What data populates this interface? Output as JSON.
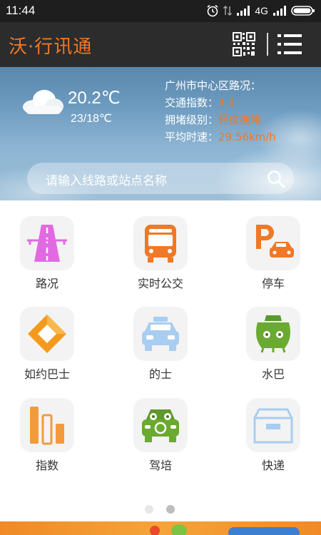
{
  "status_bar": {
    "time": "11:44",
    "network": "4G"
  },
  "app": {
    "title": "沃·行讯通"
  },
  "weather": {
    "temperature": "20.2℃",
    "range": "23/18℃",
    "icon": "cloudy-icon"
  },
  "traffic": {
    "area": "广州市中心区路况：",
    "index_label": "交通指数：",
    "index_value": "4.1",
    "level_label": "拥堵级别：",
    "level_value": "轻度拥堵",
    "speed_label": "平均时速：",
    "speed_value": "29.56km/h"
  },
  "search": {
    "placeholder": "请输入线路或站点名称"
  },
  "grid": [
    {
      "label": "路况",
      "icon": "road-icon"
    },
    {
      "label": "实时公交",
      "icon": "bus-icon"
    },
    {
      "label": "停车",
      "icon": "parking-icon"
    },
    {
      "label": "如约巴士",
      "icon": "diamond-icon"
    },
    {
      "label": "的士",
      "icon": "taxi-icon"
    },
    {
      "label": "水巴",
      "icon": "ferry-icon"
    },
    {
      "label": "指数",
      "icon": "bar-chart-icon"
    },
    {
      "label": "驾培",
      "icon": "driving-school-icon"
    },
    {
      "label": "快递",
      "icon": "package-icon"
    }
  ],
  "pager": {
    "pages": 2,
    "current": 2
  },
  "colors": {
    "accent": "#f07826",
    "appbar": "#2c2c2c",
    "status": "#1e1e1e"
  }
}
